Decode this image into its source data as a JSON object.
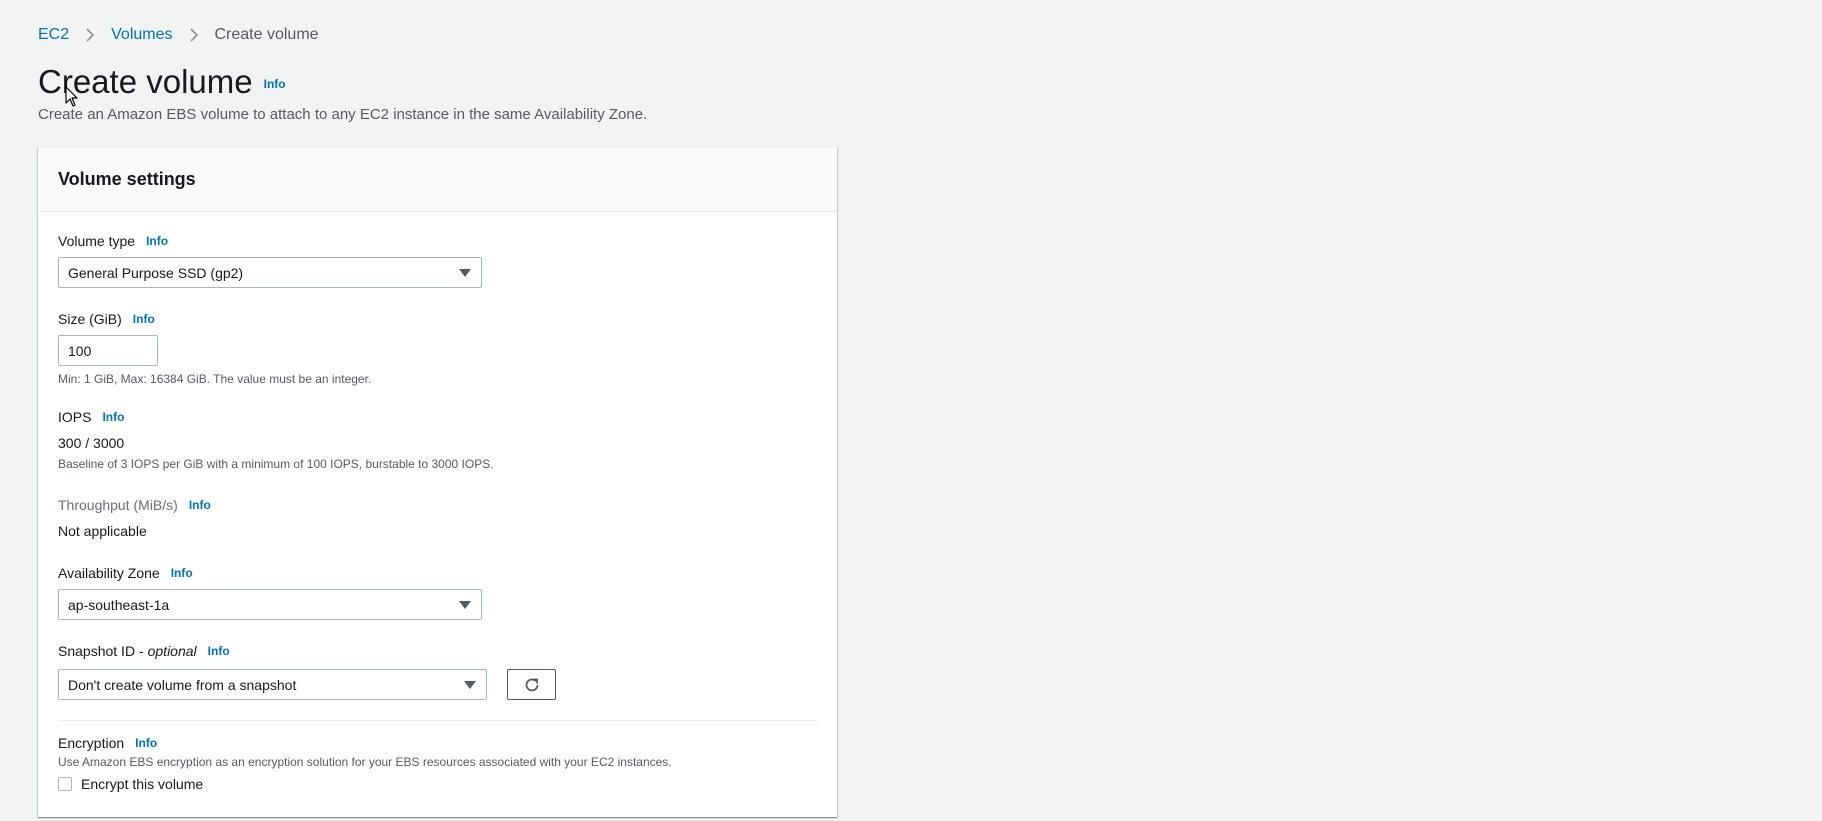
{
  "breadcrumb": {
    "items": [
      "EC2",
      "Volumes"
    ],
    "current": "Create volume"
  },
  "header": {
    "title": "Create volume",
    "info": "Info",
    "description": "Create an Amazon EBS volume to attach to any EC2 instance in the same Availability Zone."
  },
  "settings": {
    "title": "Volume settings",
    "volume_type": {
      "label": "Volume type",
      "info": "Info",
      "value": "General Purpose SSD (gp2)"
    },
    "size": {
      "label": "Size (GiB)",
      "info": "Info",
      "value": "100",
      "constraint": "Min: 1 GiB, Max: 16384 GiB. The value must be an integer."
    },
    "iops": {
      "label": "IOPS",
      "info": "Info",
      "value": "300 / 3000",
      "constraint": "Baseline of 3 IOPS per GiB with a minimum of 100 IOPS, burstable to 3000 IOPS."
    },
    "throughput": {
      "label": "Throughput (MiB/s)",
      "info": "Info",
      "value": "Not applicable"
    },
    "availability_zone": {
      "label": "Availability Zone",
      "info": "Info",
      "value": "ap-southeast-1a"
    },
    "snapshot": {
      "label": "Snapshot ID - ",
      "optional": "optional",
      "info": "Info",
      "value": "Don't create volume from a snapshot",
      "refresh_icon": "refresh-icon"
    },
    "encryption": {
      "label": "Encryption",
      "info": "Info",
      "description": "Use Amazon EBS encryption as an encryption solution for your EBS resources associated with your EC2 instances.",
      "checkbox_label": "Encrypt this volume",
      "checked": false
    }
  },
  "colors": {
    "link": "#0073bb",
    "background": "#f2f3f3",
    "panel": "#ffffff",
    "panel_header": "#fafafa"
  }
}
